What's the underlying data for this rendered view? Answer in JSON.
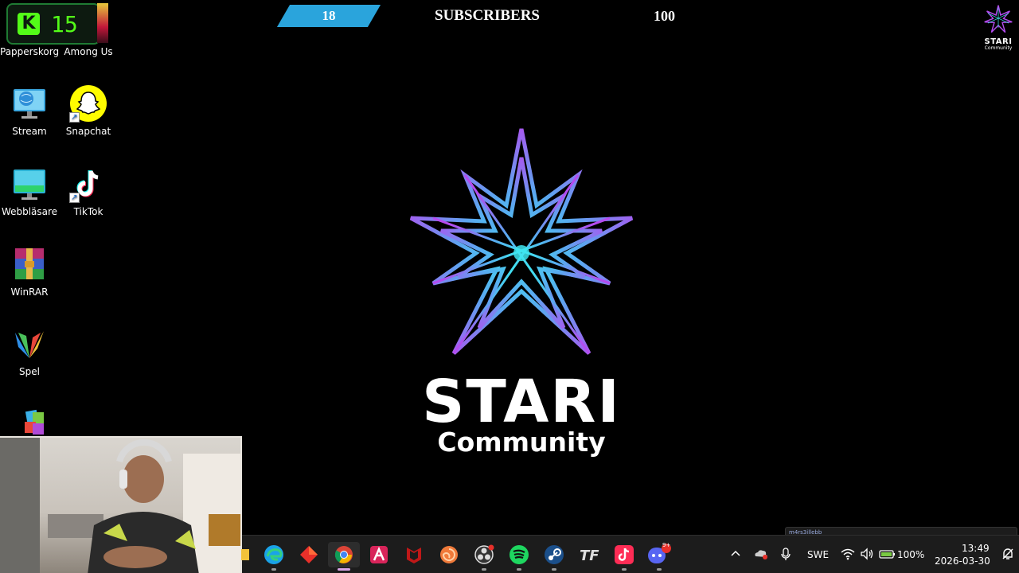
{
  "overlay": {
    "kick_count": "15",
    "subscribers_current": "18",
    "subscribers_label": "SUBSCRIBERS",
    "subscribers_goal": "100"
  },
  "desktop": {
    "icons": [
      {
        "label": "Papperskorg",
        "icon": "recycle-bin-icon"
      },
      {
        "label": "Among Us",
        "icon": "among-us-icon"
      },
      {
        "label": "Stream",
        "icon": "monitor-globe-icon"
      },
      {
        "label": "Snapchat",
        "icon": "snapchat-icon"
      },
      {
        "label": "Webbläsare",
        "icon": "monitor-icon"
      },
      {
        "label": "TikTok",
        "icon": "tiktok-icon"
      },
      {
        "label": "WinRAR",
        "icon": "winrar-icon"
      },
      {
        "label": "Spel",
        "icon": "games-icon"
      }
    ]
  },
  "wallpaper": {
    "title": "STARI",
    "subtitle": "Community",
    "corner_title": "STARI",
    "corner_subtitle": "Community",
    "colors": {
      "violet": "#b44cf0",
      "cyan": "#3ee6f0"
    }
  },
  "taskbar": {
    "apps": [
      {
        "name": "file-explorer-icon"
      },
      {
        "name": "edge-icon"
      },
      {
        "name": "red-diamond-app-icon"
      },
      {
        "name": "chrome-icon",
        "active": true
      },
      {
        "name": "affinity-icon"
      },
      {
        "name": "mcafee-icon"
      },
      {
        "name": "swirl-app-icon"
      },
      {
        "name": "obs-icon"
      },
      {
        "name": "spotify-icon"
      },
      {
        "name": "steam-icon"
      },
      {
        "name": "tf-app-icon"
      },
      {
        "name": "tiktok-icon"
      },
      {
        "name": "discord-icon",
        "badge": "9+"
      }
    ],
    "tray": {
      "language": "SWE",
      "battery": "100%",
      "time": "13:49",
      "date": "2026-03-30",
      "notification_text": "m4rs3illebb"
    }
  }
}
